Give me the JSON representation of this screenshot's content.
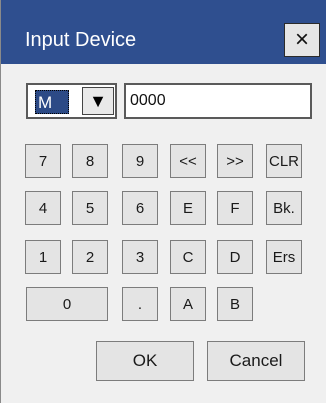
{
  "window": {
    "title": "Input Device",
    "close_icon": "×"
  },
  "device": {
    "selected": "M",
    "arrow_icon": "▼",
    "address": "0000"
  },
  "keypad": {
    "row1": [
      "7",
      "8",
      "9",
      "<<",
      ">>",
      "CLR"
    ],
    "row2": [
      "4",
      "5",
      "6",
      "E",
      "F",
      "Bk."
    ],
    "row3": [
      "1",
      "2",
      "3",
      "C",
      "D",
      "Ers"
    ],
    "row4": [
      "0",
      ".",
      "A",
      "B"
    ]
  },
  "buttons": {
    "ok": "OK",
    "cancel": "Cancel"
  }
}
